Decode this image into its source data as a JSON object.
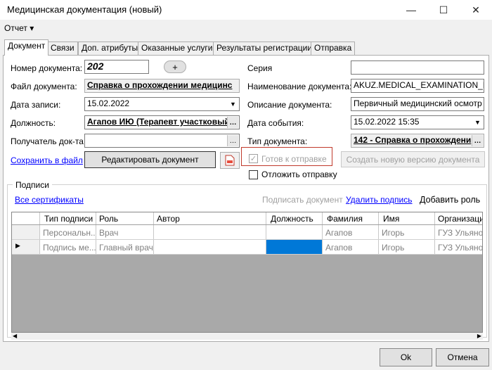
{
  "window": {
    "title": "Медицинская документация (новый)",
    "minimize": "—",
    "maximize": "☐",
    "close": "✕"
  },
  "menu": {
    "report": "Отчет ▾"
  },
  "tabs": [
    "Документ",
    "Связи",
    "Доп. атрибуты",
    "Оказанные услуги",
    "Результаты регистрации",
    "Отправка"
  ],
  "form": {
    "doc_number_label": "Номер документа:",
    "doc_number_value": "202",
    "add_btn": "+",
    "series_label": "Серия",
    "series_value": "",
    "doc_file_label": "Файл документа:",
    "doc_file_value": "Справка о прохождении медицинс",
    "doc_name_label": "Наименование документа:",
    "doc_name_value": "AKUZ.MEDICAL_EXAMINATION_MAI",
    "record_date_label": "Дата записи:",
    "record_date_value": "15.02.2022",
    "doc_desc_label": "Описание документа:",
    "doc_desc_value": "Первичный медицинский осмотр",
    "position_label": "Должность:",
    "position_value": "Агапов ИЮ (Терапевт участковый)",
    "event_date_label": "Дата события:",
    "event_date_value": "15.02.2022 15:35",
    "recipient_label": "Получатель док-та",
    "recipient_value": "",
    "doc_type_label": "Тип документа:",
    "doc_type_value": "142 - Справка о прохождени",
    "save_to_file": "Сохранить в файл",
    "edit_doc_btn": "Редактировать документ",
    "ready_to_send": "Готов к отправке",
    "create_version_btn": "Создать новую версию документа",
    "postpone_send": "Отложить отправку"
  },
  "signatures": {
    "group_title": "Подписи",
    "all_certs": "Все сертификаты",
    "sign_doc": "Подписать документ",
    "delete_sig": "Удалить подпись",
    "add_role": "Добавить роль",
    "columns": [
      "Тип подписи",
      "Роль",
      "Автор",
      "Должность",
      "Фамилия",
      "Имя",
      "Организация"
    ],
    "rows": [
      [
        "Персональн...",
        "Врач",
        "",
        "",
        "Агапов",
        "Игорь",
        "ГУЗ Ульянов"
      ],
      [
        "Подпись ме...",
        "Главный врач",
        "",
        "",
        "Агапов",
        "Игорь",
        "ГУЗ Ульянов"
      ]
    ],
    "selected_marker": "▶"
  },
  "footer": {
    "ok": "Ok",
    "cancel": "Отмена"
  },
  "colors": {
    "highlight_cell": "#0078d7",
    "ready_box_border": "#c0392b",
    "link": "#0000ff"
  }
}
